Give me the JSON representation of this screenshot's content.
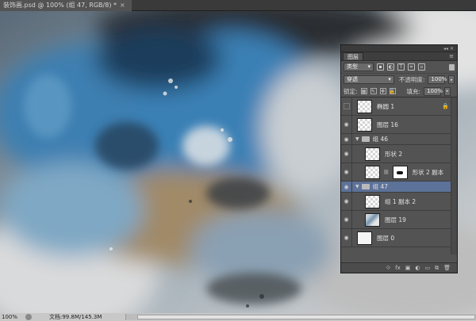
{
  "document": {
    "tab_title": "装饰画.psd @ 100% (组 47, RGB/8) *",
    "close_glyph": "×"
  },
  "status_bar": {
    "zoom": "100%",
    "doc_info": "文档:99.8M/145.3M",
    "arrow_glyph": "▶"
  },
  "layers_panel": {
    "tab_label": "图层",
    "dock_glyphs": "◂◂ ✕",
    "menu_glyph": "≡",
    "filter": {
      "kind_label": "类型",
      "icons": [
        "image-filter-icon",
        "adjustment-filter-icon",
        "type-filter-icon",
        "shape-filter-icon",
        "smart-object-filter-icon"
      ]
    },
    "blend_mode": "穿透",
    "opacity_label": "不透明度:",
    "opacity_value": "100%",
    "lock_label": "锁定:",
    "fill_label": "填充:",
    "fill_value": "100%",
    "layers": [
      {
        "name": "椭圆 1",
        "type": "layer",
        "visible": false,
        "locked": true
      },
      {
        "name": "图层 16",
        "type": "layer",
        "visible": true,
        "locked": false
      },
      {
        "name": "组 46",
        "type": "group",
        "visible": true,
        "expanded": true
      },
      {
        "name": "形状 2",
        "type": "layer",
        "visible": true,
        "indented": true
      },
      {
        "name": "形状 2 副本",
        "type": "layer",
        "visible": true,
        "indented": true,
        "has_mask": true
      },
      {
        "name": "组 47",
        "type": "group",
        "visible": true,
        "selected": true
      },
      {
        "name": "组 1 副本 2",
        "type": "layer",
        "visible": true,
        "indented": true
      },
      {
        "name": "图层 19",
        "type": "layer",
        "visible": true,
        "indented": true
      },
      {
        "name": "图层 0",
        "type": "layer",
        "visible": true
      }
    ],
    "footer_icons": [
      "link-layers-icon",
      "fx-icon",
      "add-mask-icon",
      "adjustment-layer-icon",
      "new-group-icon",
      "new-layer-icon",
      "delete-layer-icon"
    ],
    "footer_glyphs": {
      "link": "⟐",
      "fx": "fx",
      "mask": "▣",
      "adjust": "◐",
      "group": "▭",
      "new": "⧉",
      "delete": "🗑"
    }
  },
  "colors": {
    "accent_selected": "#5d7299",
    "panel_bg": "#535353",
    "canvas_blue": "#3f7fb0",
    "canvas_tan": "#a08a68"
  }
}
